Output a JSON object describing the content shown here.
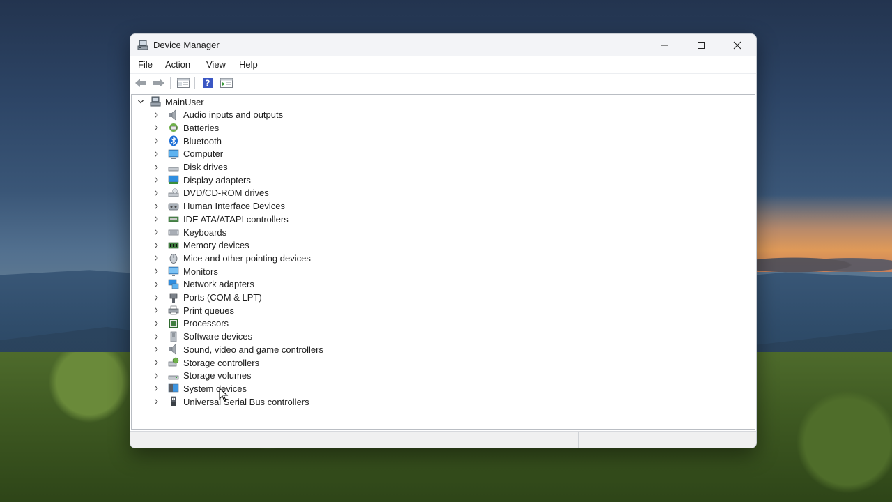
{
  "window": {
    "title": "Device Manager"
  },
  "menu": [
    "File",
    "Action",
    "View",
    "Help"
  ],
  "toolbar": {
    "buttons": [
      "back-icon",
      "forward-icon",
      "properties-pane-icon",
      "help-icon",
      "action-pane-icon"
    ]
  },
  "tree": {
    "root": "MainUser",
    "categories": [
      {
        "label": "Audio inputs and outputs",
        "icon": "speaker-icon"
      },
      {
        "label": "Batteries",
        "icon": "battery-icon"
      },
      {
        "label": "Bluetooth",
        "icon": "bluetooth-icon"
      },
      {
        "label": "Computer",
        "icon": "computer-icon"
      },
      {
        "label": "Disk drives",
        "icon": "disk-drive-icon"
      },
      {
        "label": "Display adapters",
        "icon": "display-adapter-icon"
      },
      {
        "label": "DVD/CD-ROM drives",
        "icon": "dvd-drive-icon"
      },
      {
        "label": "Human Interface Devices",
        "icon": "hid-icon"
      },
      {
        "label": "IDE ATA/ATAPI controllers",
        "icon": "ide-controller-icon"
      },
      {
        "label": "Keyboards",
        "icon": "keyboard-icon"
      },
      {
        "label": "Memory devices",
        "icon": "memory-icon"
      },
      {
        "label": "Mice and other pointing devices",
        "icon": "mouse-icon"
      },
      {
        "label": "Monitors",
        "icon": "monitor-icon"
      },
      {
        "label": "Network adapters",
        "icon": "network-adapter-icon"
      },
      {
        "label": "Ports (COM & LPT)",
        "icon": "port-icon"
      },
      {
        "label": "Print queues",
        "icon": "printer-icon"
      },
      {
        "label": "Processors",
        "icon": "processor-icon"
      },
      {
        "label": "Software devices",
        "icon": "software-device-icon"
      },
      {
        "label": "Sound, video and game controllers",
        "icon": "sound-icon"
      },
      {
        "label": "Storage controllers",
        "icon": "storage-controller-icon"
      },
      {
        "label": "Storage volumes",
        "icon": "storage-volume-icon"
      },
      {
        "label": "System devices",
        "icon": "system-devices-icon"
      },
      {
        "label": "Universal Serial Bus controllers",
        "icon": "usb-icon"
      }
    ]
  },
  "colors": {
    "accent": "#1a73d9",
    "titlebar": "#f3f4f7"
  }
}
